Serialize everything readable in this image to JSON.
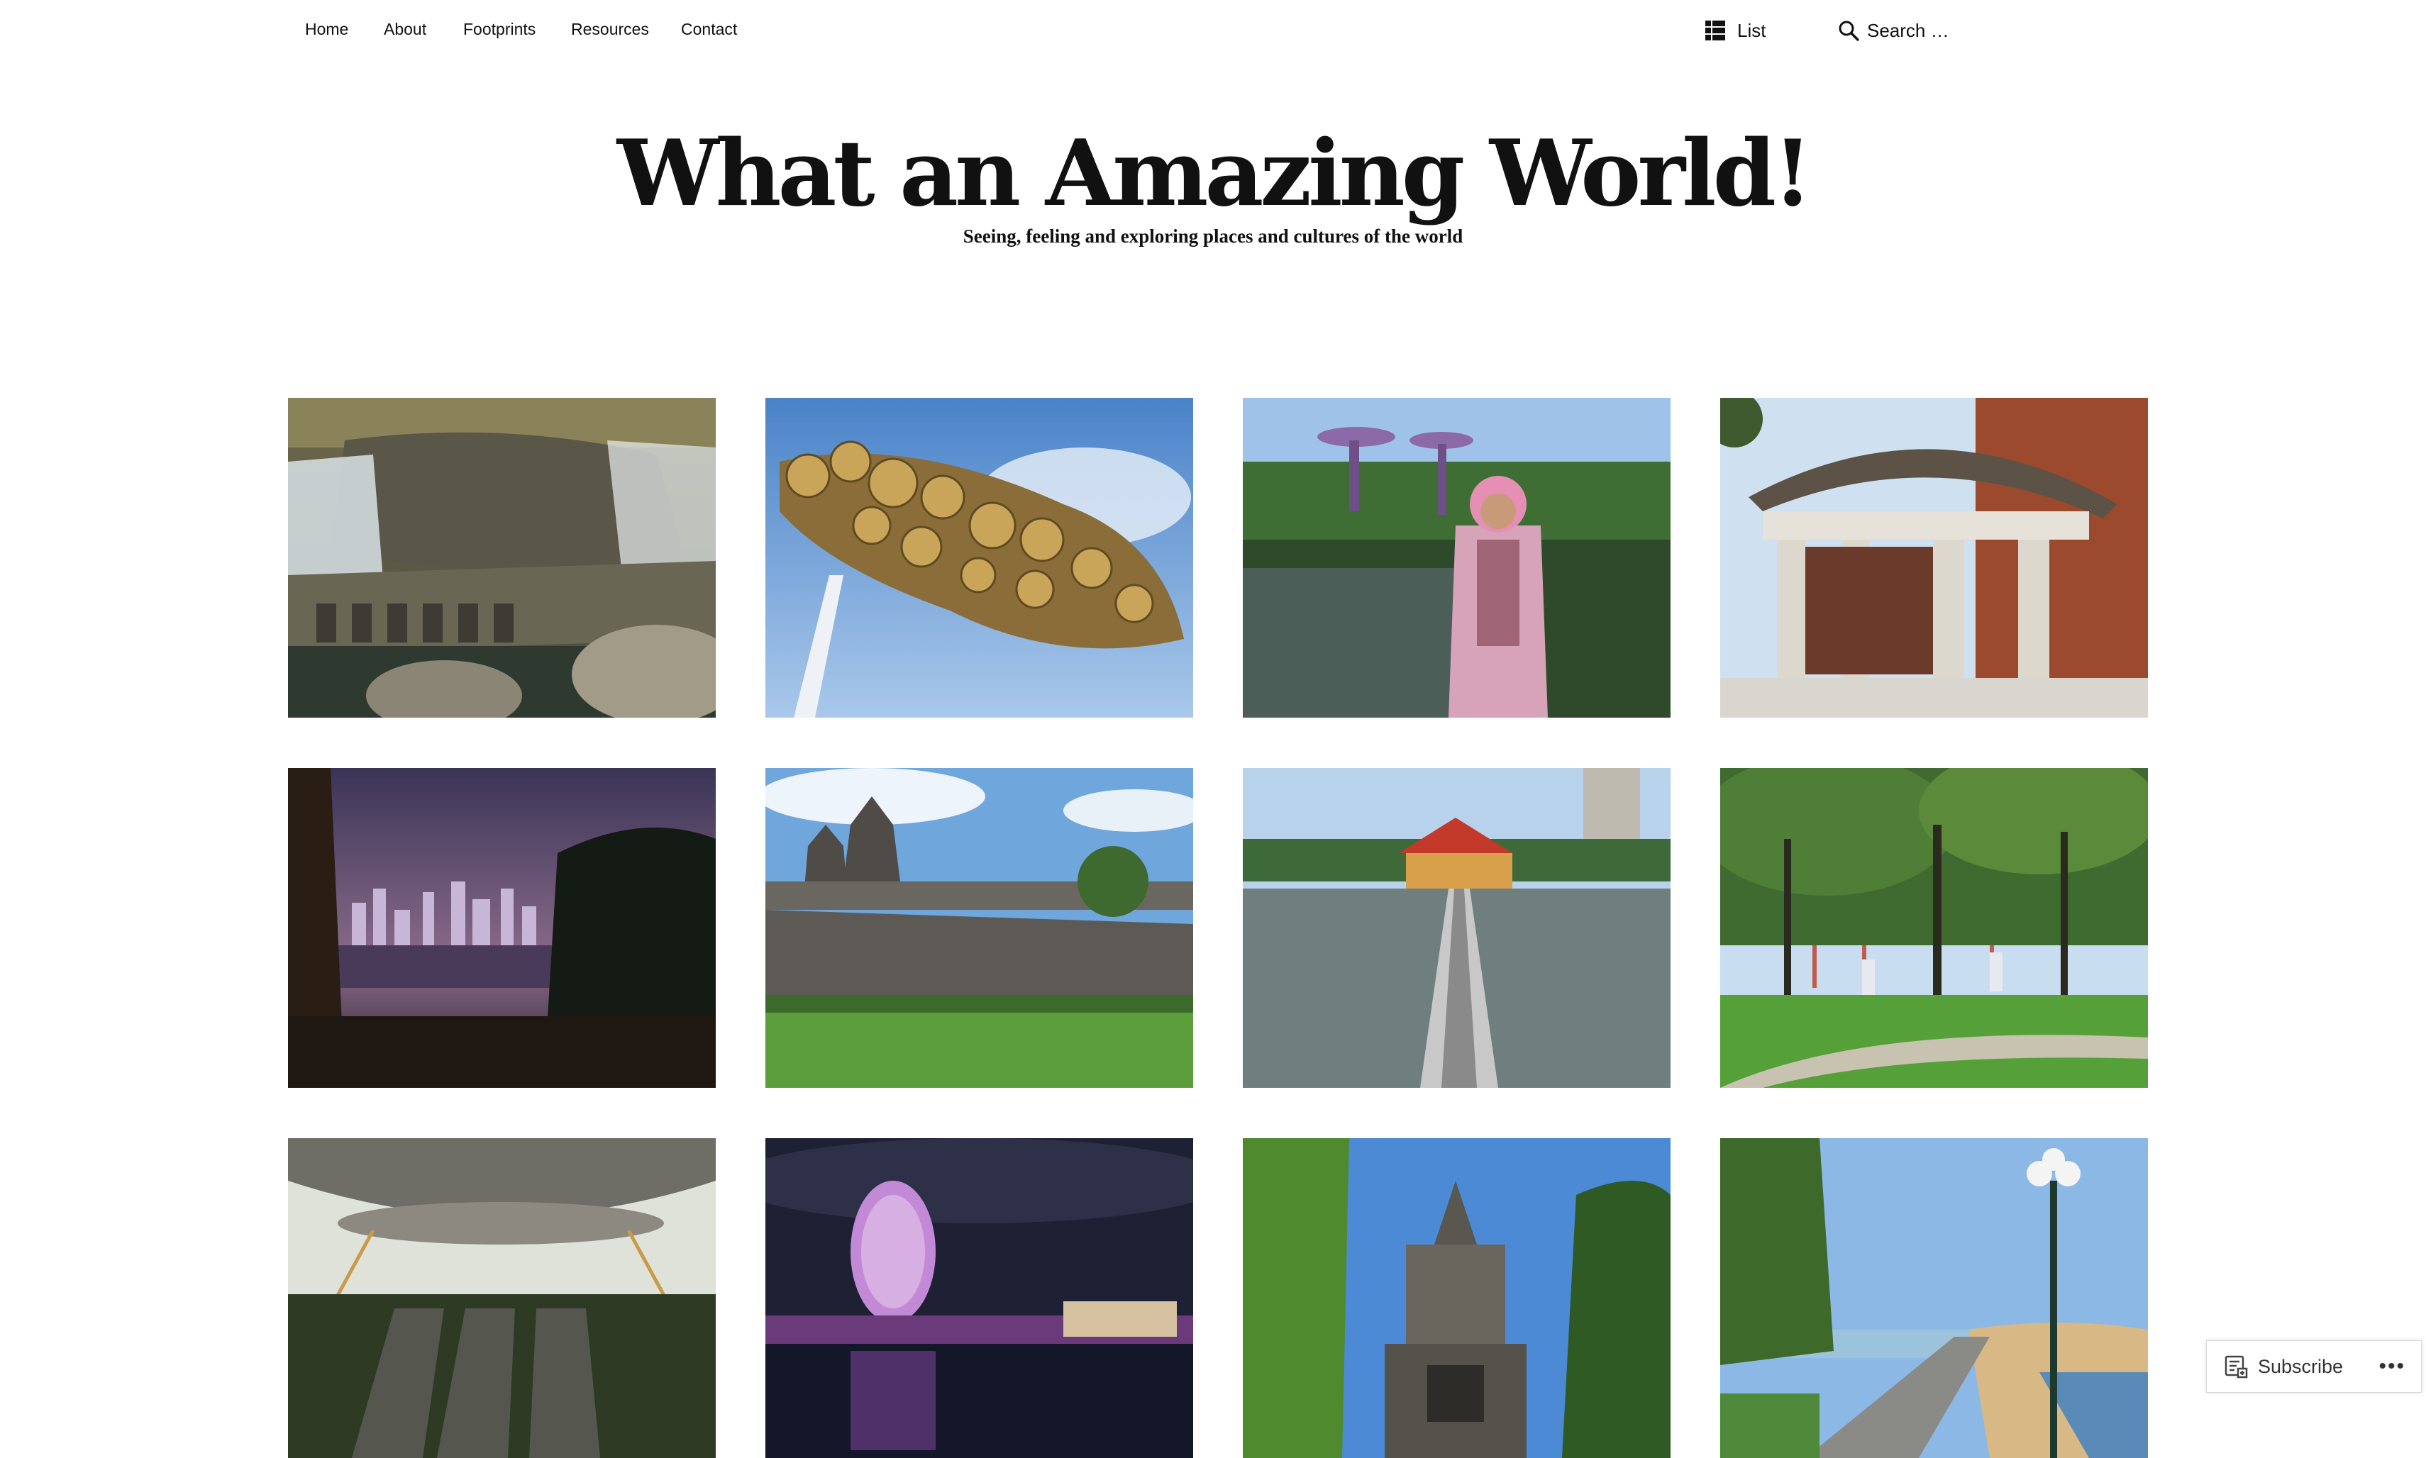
{
  "nav": {
    "items": [
      {
        "label": "Home"
      },
      {
        "label": "About"
      },
      {
        "label": "Footprints"
      },
      {
        "label": "Resources"
      },
      {
        "label": "Contact"
      }
    ],
    "view_toggle_label": "List",
    "view_toggle_icon": "grid-list-icon",
    "search_placeholder": "Search …",
    "search_icon": "search-icon"
  },
  "header": {
    "site_title": "What an Amazing World!",
    "tagline": "Seeing, feeling and exploring places and cultures of the world"
  },
  "subscribe": {
    "label": "Subscribe",
    "icon": "reader-icon",
    "more": "•••"
  }
}
